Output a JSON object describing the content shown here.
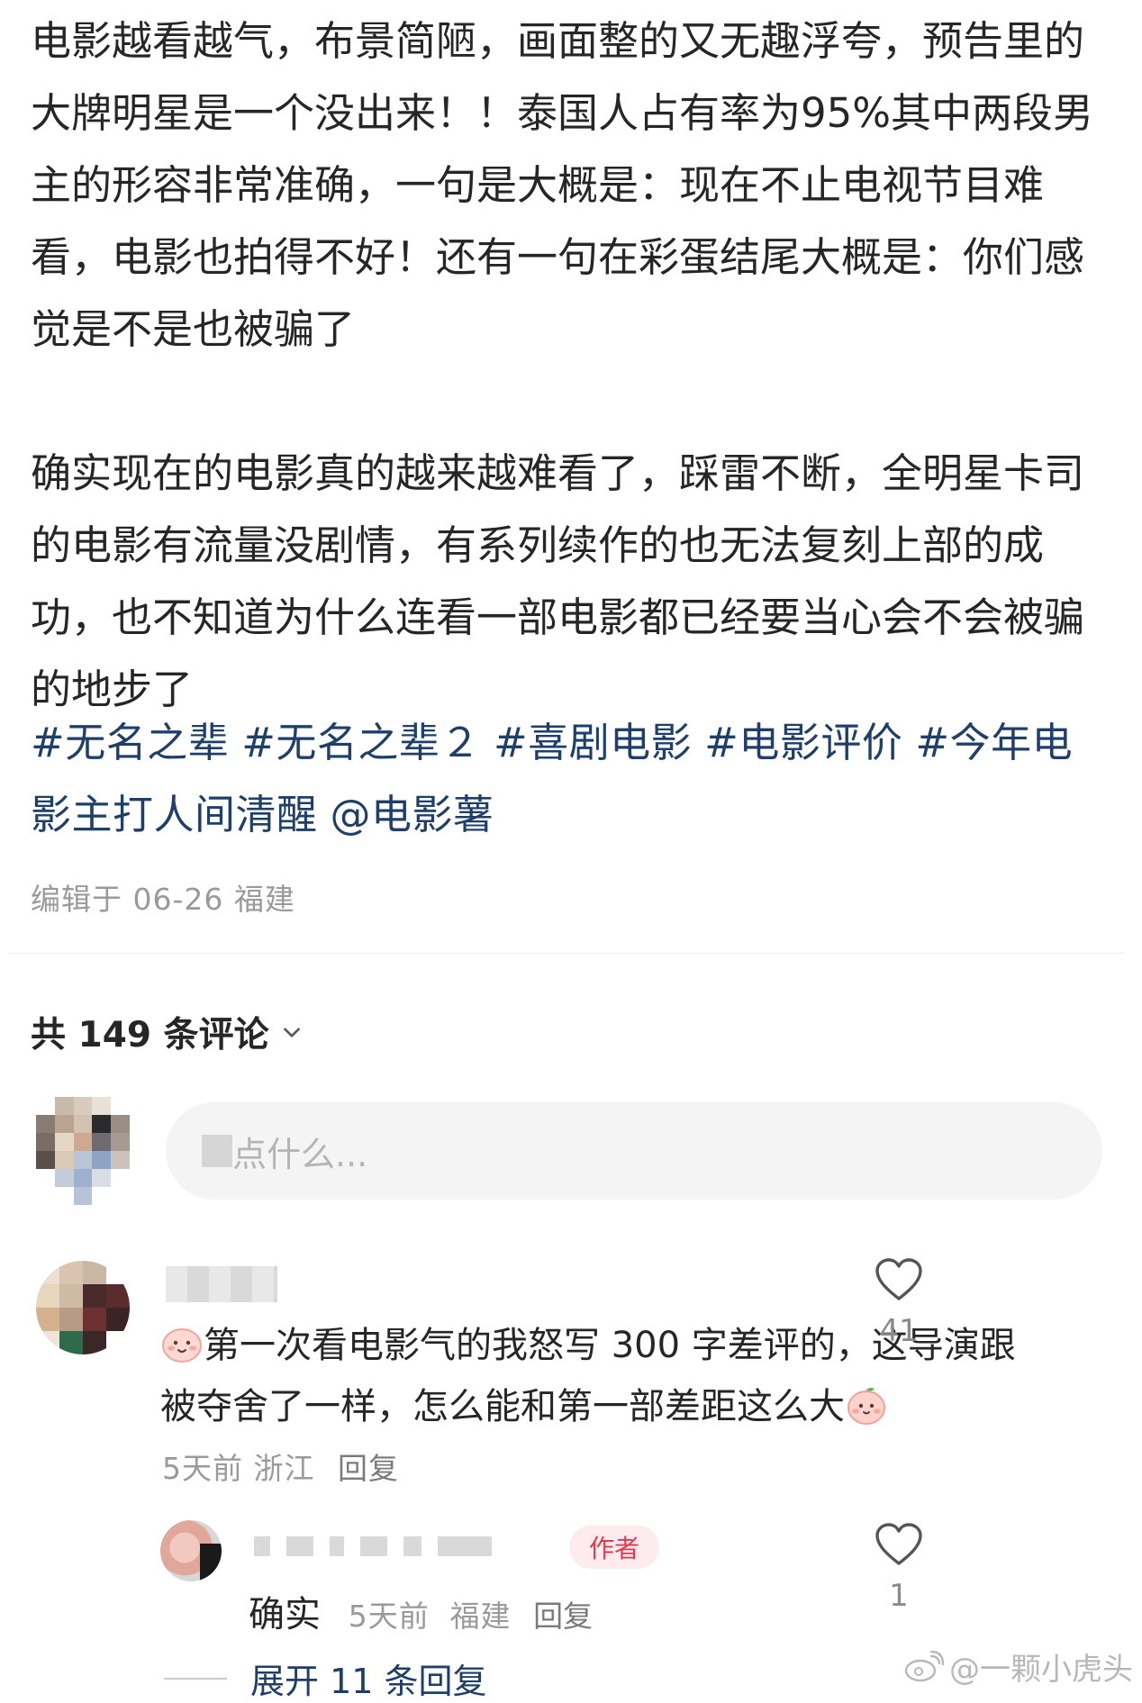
{
  "post": {
    "paragraph1": "电影越看越气，布景简陋，画面整的又无趣浮夸，预告里的大牌明星是一个没出来！！泰国人占有率为95%其中两段男主的形容非常准确，一句是大概是：现在不止电视节目难看，电影也拍得不好！还有一句在彩蛋结尾大概是：你们感觉是不是也被骗了",
    "paragraph2": "确实现在的电影真的越来越难看了，踩雷不断，全明星卡司的电影有流量没剧情，有系列续作的也无法复刻上部的成功，也不知道为什么连看一部电影都已经要当心会不会被骗的地步了",
    "tags": [
      "#无名之辈",
      "#无名之辈２",
      "#喜剧电影",
      "#电影评价",
      "#今年电影主打人间清醒",
      "@电影薯"
    ],
    "edit_info": "编辑于 06-26 福建"
  },
  "comments_header": "共 149 条评论",
  "comment_input": {
    "placeholder": "点什么..."
  },
  "comments": [
    {
      "text_main": "第一次看电影气的我怒写 300 字差评的，这导演跟被夺舍了一样，怎么能和第一部差距这么大",
      "time": "5天前",
      "location": "浙江",
      "reply_label": "回复",
      "likes": "41"
    }
  ],
  "reply": {
    "badge": "作者",
    "text": "确实",
    "time": "5天前",
    "location": "福建",
    "reply_label": "回复",
    "likes": "1"
  },
  "expand_label": "展开 11 条回复",
  "watermark": "@一颗小虎头",
  "colors": {
    "link": "#1f3f6b",
    "badge_text": "#e4394f",
    "badge_bg": "#fdebee"
  }
}
